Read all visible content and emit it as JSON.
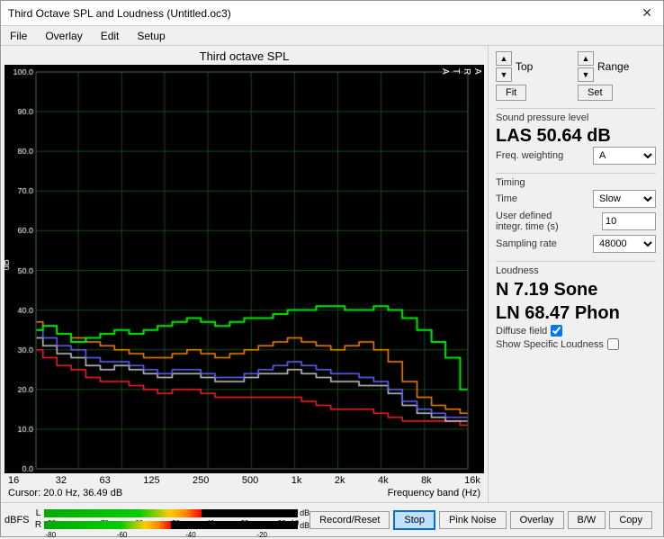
{
  "window": {
    "title": "Third Octave SPL and Loudness (Untitled.oc3)"
  },
  "menu": {
    "items": [
      "File",
      "Overlay",
      "Edit",
      "Setup"
    ]
  },
  "chart": {
    "title": "Third octave SPL",
    "arta_label": "A\nR\nT\nA",
    "y_axis_label": "dB",
    "y_max": "100.0",
    "cursor_text": "Cursor:  20.0 Hz, 36.49 dB",
    "freq_band_label": "Frequency band (Hz)",
    "x_labels": [
      "16",
      "32",
      "63",
      "125",
      "250",
      "500",
      "1k",
      "2k",
      "4k",
      "8k",
      "16k"
    ]
  },
  "nav_controls": {
    "top_label": "Top",
    "range_label": "Range",
    "fit_label": "Fit",
    "set_label": "Set"
  },
  "spl": {
    "section_label": "Sound pressure level",
    "value": "LAS 50.64 dB",
    "freq_weighting_label": "Freq. weighting",
    "freq_weighting_value": "A"
  },
  "timing": {
    "section_label": "Timing",
    "time_label": "Time",
    "time_value": "Slow",
    "user_defined_label": "User defined\nintegr. time (s)",
    "user_defined_value": "10",
    "sampling_rate_label": "Sampling rate",
    "sampling_rate_value": "48000"
  },
  "loudness": {
    "section_label": "Loudness",
    "n_value": "N 7.19 Sone",
    "ln_value": "LN 68.47 Phon",
    "diffuse_field_label": "Diffuse field",
    "diffuse_field_checked": true,
    "show_specific_label": "Show Specific Loudness",
    "show_specific_checked": false
  },
  "bottom_buttons": {
    "record_reset": "Record/Reset",
    "stop": "Stop",
    "pink_noise": "Pink Noise",
    "overlay": "Overlay",
    "bw": "B/W",
    "copy": "Copy"
  },
  "dbfs": {
    "label": "dBFS",
    "scale_labels": [
      "-90",
      "-70",
      "-60",
      "-50",
      "-40",
      "-30",
      "-20",
      "-10",
      "dB"
    ],
    "scale_labels_r": [
      "-80",
      "-60",
      "-40",
      "-20",
      "dB"
    ],
    "channel_l": "L",
    "channel_r": "R",
    "l_fill_pct": 62,
    "r_fill_pct": 50
  }
}
